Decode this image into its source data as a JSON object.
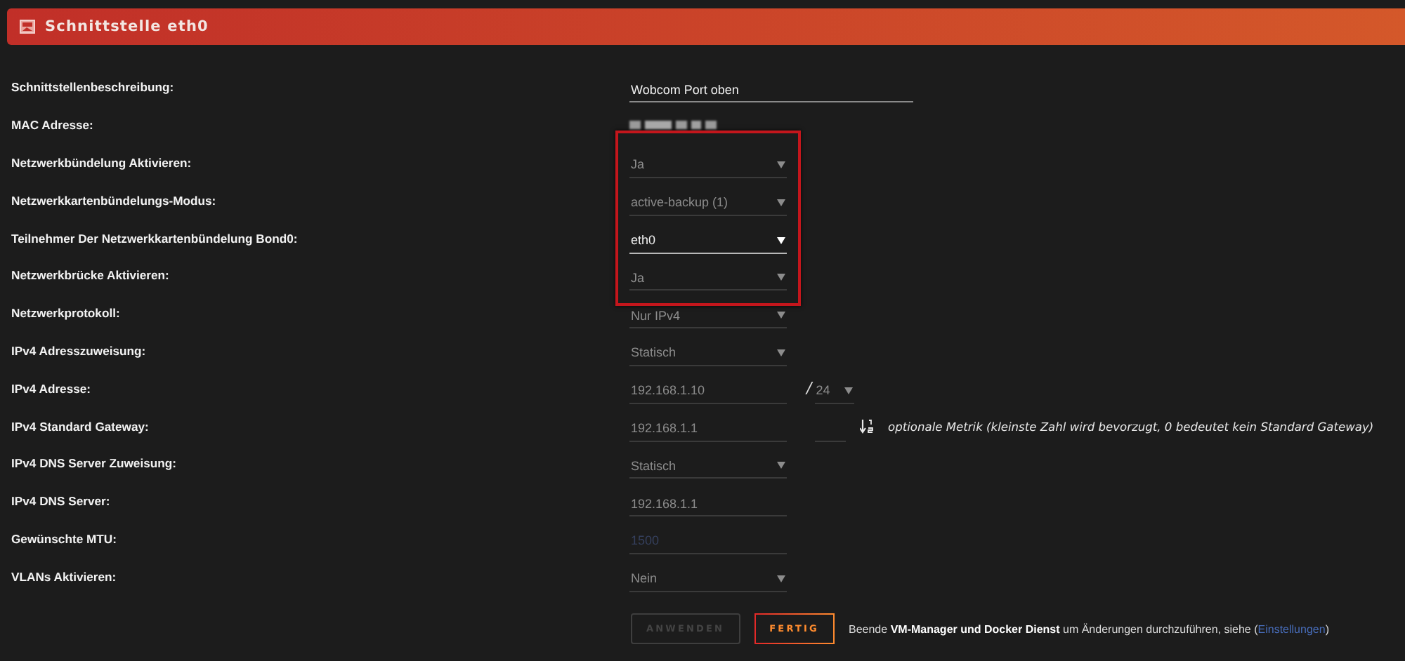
{
  "header": {
    "title": "Schnittstelle eth0"
  },
  "sections": [
    {
      "highlighted": false,
      "rows": [
        {
          "label": "Schnittstellenbeschreibung:",
          "kind": "text",
          "value": "Wobcom Port oben",
          "disabled": false
        },
        {
          "label": "MAC Adresse:",
          "kind": "blurred"
        }
      ]
    },
    {
      "highlighted": true,
      "rows": [
        {
          "label": "Netzwerkbündelung Aktivieren:",
          "kind": "select",
          "value": "Ja",
          "disabled": true
        },
        {
          "label": "Netzwerkkartenbündelungs-Modus:",
          "kind": "select",
          "value": "active-backup (1)",
          "disabled": true
        },
        {
          "label": "Teilnehmer Der Netzwerkkartenbündelung Bond0:",
          "kind": "select",
          "value": "eth0",
          "disabled": false
        },
        {
          "label": "Netzwerkbrücke Aktivieren:",
          "kind": "select",
          "value": "Ja",
          "disabled": true
        }
      ]
    },
    {
      "highlighted": false,
      "rows": [
        {
          "label": "Netzwerkprotokoll:",
          "kind": "select",
          "value": "Nur IPv4",
          "disabled": true
        },
        {
          "label": "IPv4 Adresszuweisung:",
          "kind": "select",
          "value": "Statisch",
          "disabled": true
        },
        {
          "label": "IPv4 Adresse:",
          "kind": "address",
          "value": "192.168.1.10",
          "disabled": true,
          "separator": "/",
          "prefix": "24"
        },
        {
          "label": "IPv4 Standard Gateway:",
          "kind": "gateway",
          "value": "192.168.1.1",
          "disabled": true,
          "hint": "optionale Metrik (kleinste Zahl wird bevorzugt, 0 bedeutet kein Standard Gateway)"
        },
        {
          "label": "IPv4 DNS Server Zuweisung:",
          "kind": "select",
          "value": "Statisch",
          "disabled": true
        },
        {
          "label": "IPv4 DNS Server:",
          "kind": "text",
          "value": "192.168.1.1",
          "disabled": true
        },
        {
          "label": "Gewünschte MTU:",
          "kind": "text",
          "placeholder": "1500",
          "disabled": true
        },
        {
          "label": "VLANs Aktivieren:",
          "kind": "select",
          "value": "Nein",
          "disabled": true
        }
      ]
    }
  ],
  "buttons": [
    {
      "label": "ANWENDEN",
      "disabled": true
    },
    {
      "label": "FERTIG",
      "disabled": false
    }
  ],
  "note": {
    "text": "Beende **VM-Manager und Docker Dienst** um Änderungen durchzuführen, siehe (",
    "link": "Einstellungen",
    "end": ")"
  }
}
